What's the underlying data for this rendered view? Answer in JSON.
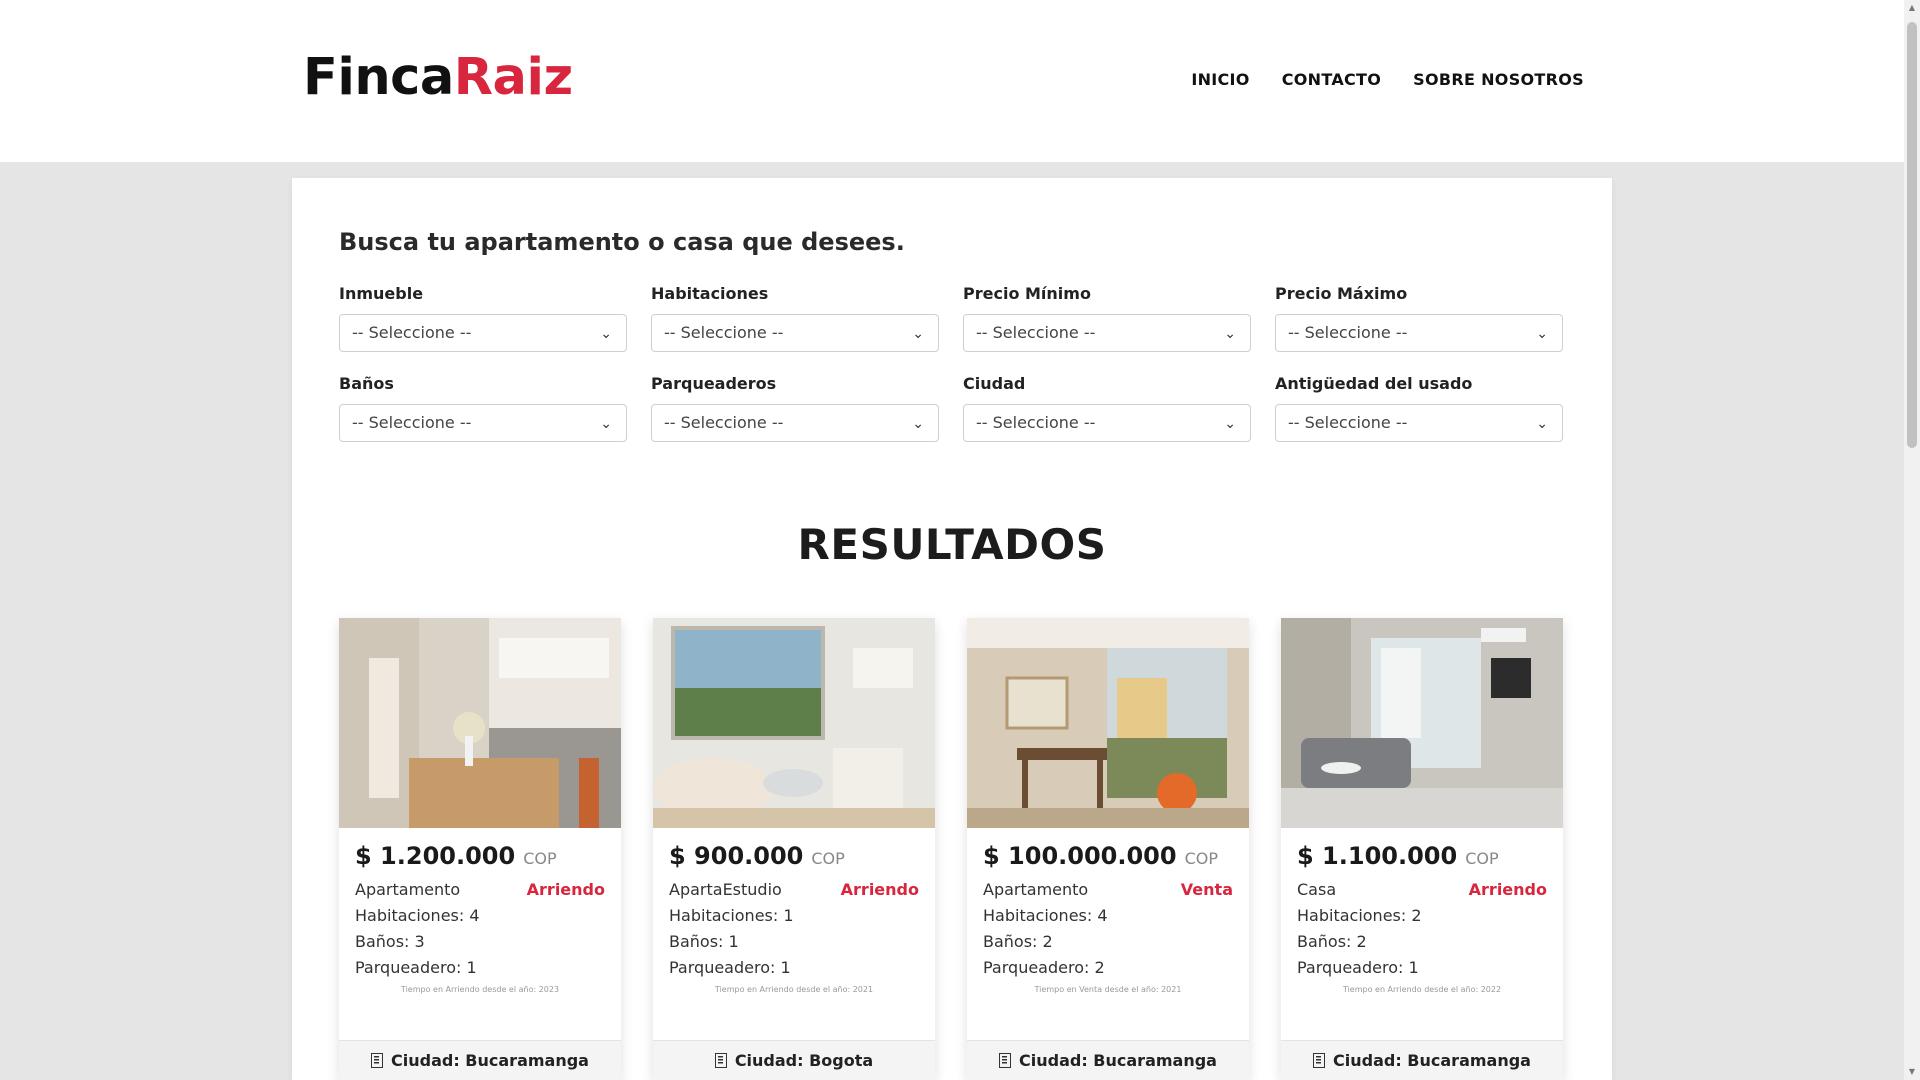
{
  "brand": {
    "part1": "Finca",
    "part2": "Raiz",
    "accent": "#d7263d"
  },
  "nav": {
    "items": [
      "INICIO",
      "CONTACTO",
      "SOBRE NOSOTROS"
    ]
  },
  "search": {
    "title": "Busca tu apartamento o casa que desees.",
    "filters": [
      {
        "label": "Inmueble",
        "value": "-- Seleccione --"
      },
      {
        "label": "Habitaciones",
        "value": "-- Seleccione --"
      },
      {
        "label": "Precio Mínimo",
        "value": "-- Seleccione --"
      },
      {
        "label": "Precio Máximo",
        "value": "-- Seleccione --"
      },
      {
        "label": "Baños",
        "value": "-- Seleccione --"
      },
      {
        "label": "Parqueaderos",
        "value": "-- Seleccione --"
      },
      {
        "label": "Ciudad",
        "value": "-- Seleccione --"
      },
      {
        "label": "Antigüedad del usado",
        "value": "-- Seleccione --"
      }
    ]
  },
  "results": {
    "title": "RESULTADOS",
    "cards": [
      {
        "price": "$ 1.200.000",
        "currency": "COP",
        "type": "Apartamento",
        "operation": "Arriendo",
        "rooms": "Habitaciones: 4",
        "baths": "Baños: 3",
        "parking": "Parqueadero: 1",
        "note": "Tiempo en Arriendo desde el año: 2023",
        "city": "Ciudad: Bucaramanga",
        "photo_icon": "kitchen-photo"
      },
      {
        "price": "$ 900.000",
        "currency": "COP",
        "type": "ApartaEstudio",
        "operation": "Arriendo",
        "rooms": "Habitaciones: 1",
        "baths": "Baños: 1",
        "parking": "Parqueadero: 1",
        "note": "Tiempo en Arriendo desde el año: 2021",
        "city": "Ciudad: Bogota",
        "photo_icon": "living-room-photo"
      },
      {
        "price": "$ 100.000.000",
        "currency": "COP",
        "type": "Apartamento",
        "operation": "Venta",
        "rooms": "Habitaciones: 4",
        "baths": "Baños: 2",
        "parking": "Parqueadero: 2",
        "note": "Tiempo en Venta desde el año: 2021",
        "city": "Ciudad: Bucaramanga",
        "photo_icon": "dining-room-photo"
      },
      {
        "price": "$ 1.100.000",
        "currency": "COP",
        "type": "Casa",
        "operation": "Arriendo",
        "rooms": "Habitaciones: 2",
        "baths": "Baños: 2",
        "parking": "Parqueadero: 1",
        "note": "Tiempo en Arriendo desde el año: 2022",
        "city": "Ciudad: Bucaramanga",
        "photo_icon": "lounge-photo"
      }
    ]
  }
}
